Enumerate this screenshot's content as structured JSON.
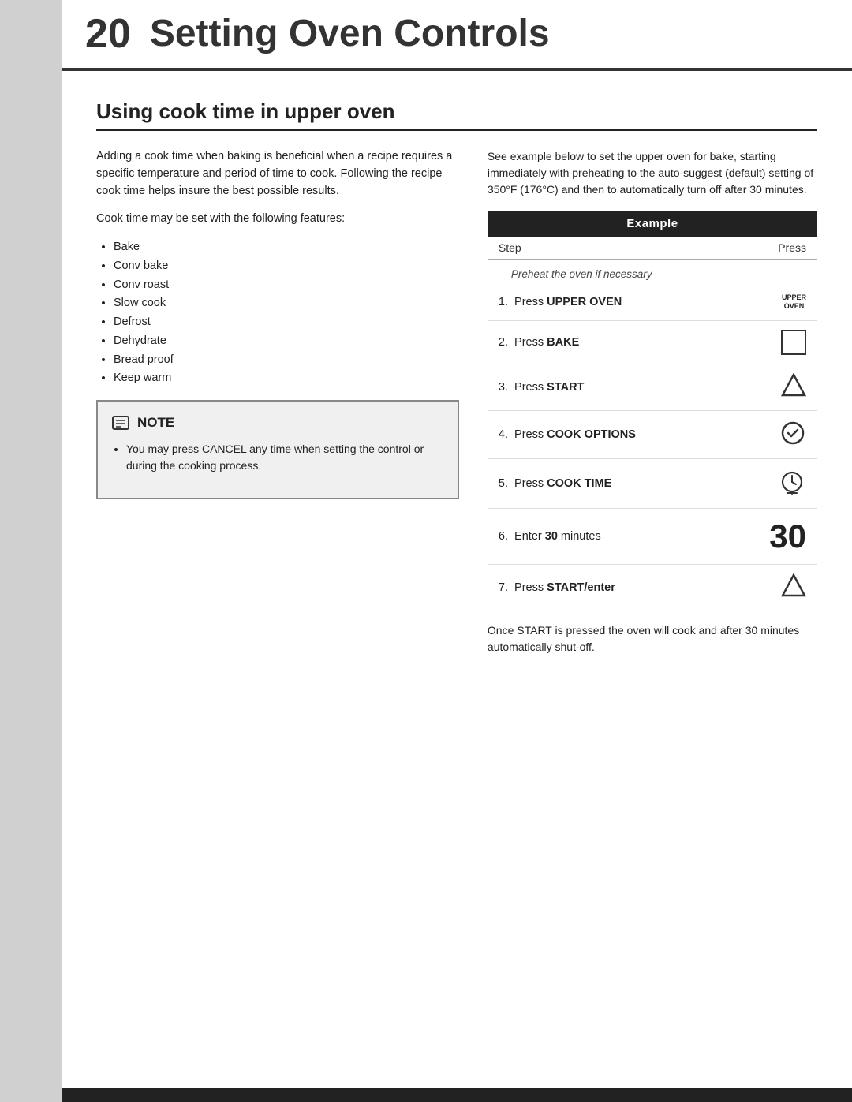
{
  "header": {
    "number": "20",
    "title": "Setting Oven Controls"
  },
  "section": {
    "title": "Using cook time in upper oven"
  },
  "left_col": {
    "para1": "Adding a cook time when baking is beneficial when a recipe requires a specific temperature and period of time to cook. Following the recipe cook time helps insure the best possible results.",
    "para2": "Cook time may be set with the following features:",
    "features": [
      "Bake",
      "Conv bake",
      "Conv roast",
      "Slow cook",
      "Defrost",
      "Dehydrate",
      "Bread proof",
      "Keep warm"
    ],
    "note": {
      "label": "NOTE",
      "items": [
        "You may press CANCEL any time when setting the control or during the cooking process."
      ]
    }
  },
  "right_col": {
    "desc": "See example below to set the upper oven for bake, starting immediately with preheating to the auto-suggest (default) setting of 350°F (176°C) and then to automatically turn off after 30 minutes.",
    "example_label": "Example",
    "col_step": "Step",
    "col_press": "Press",
    "preheat_row": "Preheat the oven if necessary",
    "steps": [
      {
        "num": "1.",
        "text_plain": "Press ",
        "text_bold": "UPPER OVEN",
        "icon": "upper-oven"
      },
      {
        "num": "2.",
        "text_plain": "Press ",
        "text_bold": "BAKE",
        "icon": "bake"
      },
      {
        "num": "3.",
        "text_plain": "Press ",
        "text_bold": "START",
        "icon": "start"
      },
      {
        "num": "4.",
        "text_plain": "Press ",
        "text_bold": "COOK OPTIONS",
        "icon": "cook-options"
      },
      {
        "num": "5.",
        "text_plain": "Press ",
        "text_bold": "COOK TIME",
        "icon": "cook-time"
      },
      {
        "num": "6.",
        "text_plain": "Enter ",
        "text_bold": "30",
        "text_after": " minutes",
        "icon": "30"
      },
      {
        "num": "7.",
        "text_plain": "Press ",
        "text_bold": "START/enter",
        "icon": "start-enter"
      }
    ],
    "footer_text": "Once START is pressed the oven will cook and after 30 minutes automatically shut-off."
  }
}
